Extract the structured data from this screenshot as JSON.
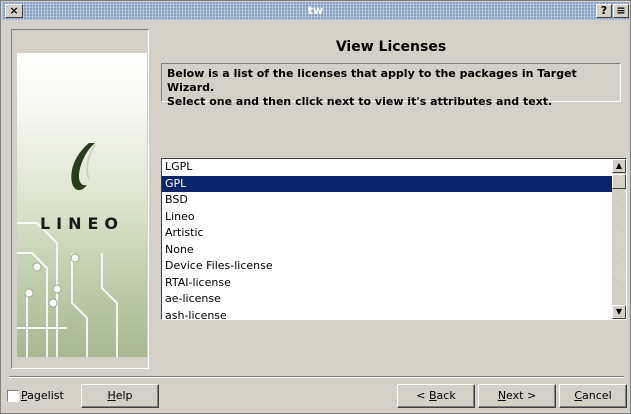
{
  "window": {
    "title": "tw",
    "close_glyph": "×",
    "help_glyph": "?",
    "menu_glyph": "≡"
  },
  "sidebar": {
    "logo_text": "LINEO"
  },
  "page": {
    "title": "View Licenses",
    "description_line1": "Below is a list of the licenses that apply to the packages in Target Wizard.",
    "description_line2": "Select one and then click next to view it's attributes and text."
  },
  "licenses": {
    "items": [
      "LGPL",
      "GPL",
      "BSD",
      "Lineo",
      "Artistic",
      "None",
      "Device Files-license",
      "RTAI-license",
      "ae-license",
      "ash-license"
    ],
    "selected": "GPL"
  },
  "footer": {
    "pagelist_label": "Pagelist",
    "help_label": "Help",
    "back_label": "< Back",
    "next_label": "Next >",
    "cancel_label": "Cancel"
  },
  "colors": {
    "selection": "#0a246a",
    "titlebar": "#8aa2c2",
    "panel": "#d4d0c8"
  }
}
